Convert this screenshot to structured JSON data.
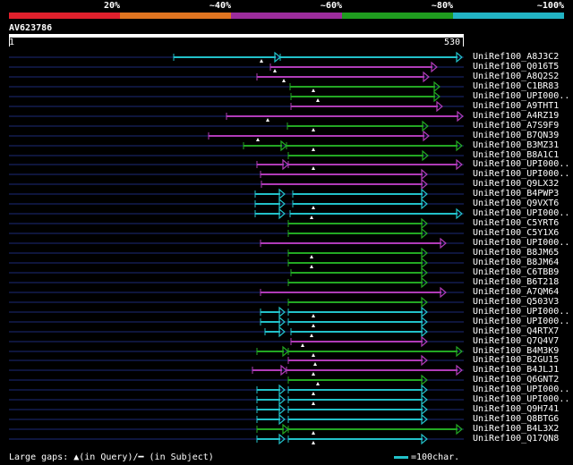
{
  "scale": {
    "labels": [
      "20%",
      "~40%",
      "~60%",
      "~80%",
      "~100%"
    ],
    "colors": [
      "#e0202c",
      "#e07420",
      "#9c2c9c",
      "#1f9c1f",
      "#22b4c4"
    ]
  },
  "query": {
    "id": "AV623786",
    "start": "1",
    "end": "530"
  },
  "legend": {
    "gaps_text": "Large gaps: ▲(in Query)/━ (in Subject)",
    "scale_text": "=100char."
  },
  "hits": [
    {
      "label": "UniRef100_A8J3C2",
      "color": "cyan",
      "segments": [
        [
          194,
          313
        ],
        [
          313,
          516
        ]
      ],
      "gap": 292
    },
    {
      "label": "UniRef100_Q016T5",
      "color": "magenta",
      "segments": [
        [
          302,
          488
        ]
      ],
      "gap": 307
    },
    {
      "label": "UniRef100_A8Q2S2",
      "color": "magenta",
      "segments": [
        [
          287,
          479
        ]
      ],
      "gap": 317
    },
    {
      "label": "UniRef100_C1BR83",
      "color": "green",
      "segments": [
        [
          324,
          491
        ]
      ],
      "gap": 350
    },
    {
      "label": "UniRef100_UPI000..",
      "color": "green",
      "segments": [
        [
          325,
          491
        ]
      ],
      "gap": 355
    },
    {
      "label": "UniRef100_A9THT1",
      "color": "magenta",
      "segments": [
        [
          325,
          494
        ]
      ],
      "gap": null
    },
    {
      "label": "UniRef100_A4RZ19",
      "color": "magenta",
      "segments": [
        [
          253,
          517
        ]
      ],
      "gap": 299
    },
    {
      "label": "UniRef100_A7S9F9",
      "color": "green",
      "segments": [
        [
          321,
          478
        ]
      ],
      "gap": 350
    },
    {
      "label": "UniRef100_B7QN39",
      "color": "magenta",
      "segments": [
        [
          233,
          479
        ]
      ],
      "gap": 288
    },
    {
      "label": "UniRef100_B3MZ31",
      "color": "green",
      "segments": [
        [
          272,
          320
        ],
        [
          320,
          516
        ]
      ],
      "gap": 350
    },
    {
      "label": "UniRef100_B8A1C1",
      "color": "green",
      "segments": [
        [
          322,
          478
        ]
      ],
      "gap": null
    },
    {
      "label": "UniRef100_UPI000..",
      "color": "magenta",
      "segments": [
        [
          287,
          322
        ],
        [
          322,
          516
        ]
      ],
      "gap": 350
    },
    {
      "label": "UniRef100_UPI000..",
      "color": "magenta",
      "segments": [
        [
          291,
          477
        ]
      ],
      "gap": null
    },
    {
      "label": "UniRef100_Q9LX32",
      "color": "magenta",
      "segments": [
        [
          292,
          477
        ]
      ],
      "gap": null
    },
    {
      "label": "UniRef100_B4PWP3",
      "color": "cyan",
      "segments": [
        [
          285,
          318
        ],
        [
          327,
          477
        ]
      ],
      "gap": null
    },
    {
      "label": "UniRef100_Q9VXT6",
      "color": "cyan",
      "segments": [
        [
          285,
          318
        ],
        [
          327,
          477
        ]
      ],
      "gap": 350
    },
    {
      "label": "UniRef100_UPI000..",
      "color": "cyan",
      "segments": [
        [
          285,
          318
        ],
        [
          324,
          516
        ]
      ],
      "gap": 348
    },
    {
      "label": "UniRef100_C5YRT6",
      "color": "green",
      "segments": [
        [
          322,
          477
        ]
      ],
      "gap": null
    },
    {
      "label": "UniRef100_C5Y1X6",
      "color": "green",
      "segments": [
        [
          322,
          477
        ]
      ],
      "gap": null
    },
    {
      "label": "UniRef100_UPI000..",
      "color": "magenta",
      "segments": [
        [
          291,
          498
        ]
      ],
      "gap": null
    },
    {
      "label": "UniRef100_B8JM65",
      "color": "green",
      "segments": [
        [
          322,
          477
        ]
      ],
      "gap": 348
    },
    {
      "label": "UniRef100_B8JM64",
      "color": "green",
      "segments": [
        [
          322,
          477
        ]
      ],
      "gap": 348
    },
    {
      "label": "UniRef100_C6TBB9",
      "color": "green",
      "segments": [
        [
          325,
          477
        ]
      ],
      "gap": null
    },
    {
      "label": "UniRef100_B6T218",
      "color": "green",
      "segments": [
        [
          322,
          477
        ]
      ],
      "gap": null
    },
    {
      "label": "UniRef100_A7QM64",
      "color": "magenta",
      "segments": [
        [
          291,
          498
        ]
      ],
      "gap": null
    },
    {
      "label": "UniRef100_Q503V3",
      "color": "green",
      "segments": [
        [
          322,
          477
        ]
      ],
      "gap": null
    },
    {
      "label": "UniRef100_UPI000..",
      "color": "cyan",
      "segments": [
        [
          291,
          318
        ],
        [
          322,
          477
        ]
      ],
      "gap": 350
    },
    {
      "label": "UniRef100_UPI000..",
      "color": "cyan",
      "segments": [
        [
          291,
          318
        ],
        [
          322,
          477
        ]
      ],
      "gap": 350
    },
    {
      "label": "UniRef100_Q4RTX7",
      "color": "cyan",
      "segments": [
        [
          296,
          318
        ],
        [
          325,
          477
        ]
      ],
      "gap": 348
    },
    {
      "label": "UniRef100_Q7Q4V7",
      "color": "magenta",
      "segments": [
        [
          325,
          477
        ]
      ],
      "gap": 338
    },
    {
      "label": "UniRef100_B4M3K9",
      "color": "green",
      "segments": [
        [
          287,
          322
        ],
        [
          322,
          516
        ]
      ],
      "gap": 350
    },
    {
      "label": "UniRef100_B2GU15",
      "color": "magenta",
      "segments": [
        [
          322,
          477
        ]
      ],
      "gap": 352
    },
    {
      "label": "UniRef100_B4JLJ1",
      "color": "magenta",
      "segments": [
        [
          282,
          320
        ],
        [
          320,
          516
        ]
      ],
      "gap": 350
    },
    {
      "label": "UniRef100_Q6GNT2",
      "color": "green",
      "segments": [
        [
          322,
          477
        ]
      ],
      "gap": 355
    },
    {
      "label": "UniRef100_UPI000..",
      "color": "cyan",
      "segments": [
        [
          287,
          318
        ],
        [
          322,
          477
        ]
      ],
      "gap": 350
    },
    {
      "label": "UniRef100_UPI000..",
      "color": "cyan",
      "segments": [
        [
          287,
          318
        ],
        [
          322,
          477
        ]
      ],
      "gap": 350
    },
    {
      "label": "UniRef100_Q9H741",
      "color": "cyan",
      "segments": [
        [
          287,
          318
        ],
        [
          322,
          477
        ]
      ],
      "gap": null
    },
    {
      "label": "UniRef100_Q8BTG6",
      "color": "cyan",
      "segments": [
        [
          287,
          318
        ],
        [
          322,
          477
        ]
      ],
      "gap": null
    },
    {
      "label": "UniRef100_B4L3X2",
      "color": "green",
      "segments": [
        [
          287,
          322
        ],
        [
          322,
          516
        ]
      ],
      "gap": 350
    },
    {
      "label": "UniRef100_Q17QN8",
      "color": "cyan",
      "segments": [
        [
          287,
          318
        ],
        [
          322,
          477
        ]
      ],
      "gap": 350
    }
  ]
}
